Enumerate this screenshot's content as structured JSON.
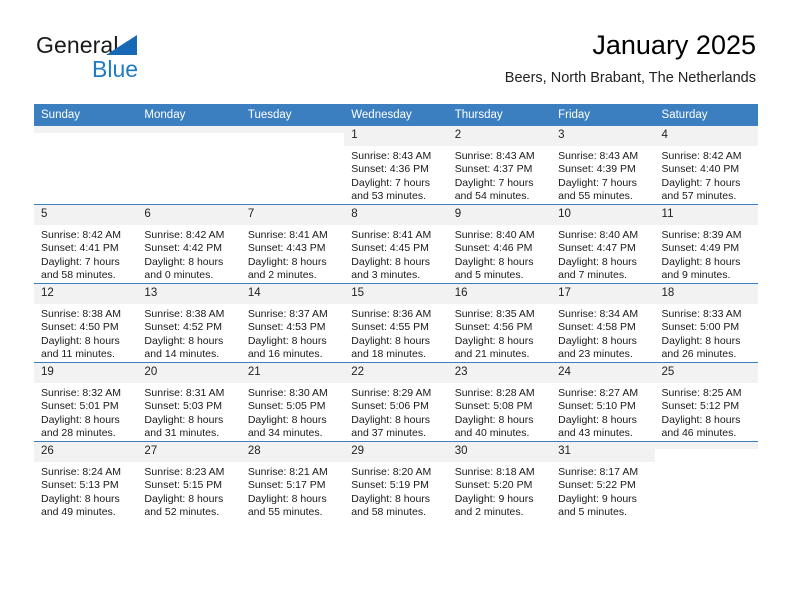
{
  "brand": {
    "name_top": "General",
    "name_bottom": "Blue",
    "accent_color": "#1f7cc4",
    "triangle_color": "#1769b5"
  },
  "header": {
    "title": "January 2025",
    "subtitle": "Beers, North Brabant, The Netherlands"
  },
  "theme": {
    "header_row_bg": "#3c7fc0",
    "daynum_bg": "#f2f2f2",
    "grid_line": "#3c7fc0",
    "text": "#1a1a1a"
  },
  "weekday_headers": [
    "Sunday",
    "Monday",
    "Tuesday",
    "Wednesday",
    "Thursday",
    "Friday",
    "Saturday"
  ],
  "weeks": [
    [
      {
        "day": "",
        "sunrise": "",
        "sunset": "",
        "daylight1": "",
        "daylight2": ""
      },
      {
        "day": "",
        "sunrise": "",
        "sunset": "",
        "daylight1": "",
        "daylight2": ""
      },
      {
        "day": "",
        "sunrise": "",
        "sunset": "",
        "daylight1": "",
        "daylight2": ""
      },
      {
        "day": "1",
        "sunrise": "Sunrise: 8:43 AM",
        "sunset": "Sunset: 4:36 PM",
        "daylight1": "Daylight: 7 hours",
        "daylight2": "and 53 minutes."
      },
      {
        "day": "2",
        "sunrise": "Sunrise: 8:43 AM",
        "sunset": "Sunset: 4:37 PM",
        "daylight1": "Daylight: 7 hours",
        "daylight2": "and 54 minutes."
      },
      {
        "day": "3",
        "sunrise": "Sunrise: 8:43 AM",
        "sunset": "Sunset: 4:39 PM",
        "daylight1": "Daylight: 7 hours",
        "daylight2": "and 55 minutes."
      },
      {
        "day": "4",
        "sunrise": "Sunrise: 8:42 AM",
        "sunset": "Sunset: 4:40 PM",
        "daylight1": "Daylight: 7 hours",
        "daylight2": "and 57 minutes."
      }
    ],
    [
      {
        "day": "5",
        "sunrise": "Sunrise: 8:42 AM",
        "sunset": "Sunset: 4:41 PM",
        "daylight1": "Daylight: 7 hours",
        "daylight2": "and 58 minutes."
      },
      {
        "day": "6",
        "sunrise": "Sunrise: 8:42 AM",
        "sunset": "Sunset: 4:42 PM",
        "daylight1": "Daylight: 8 hours",
        "daylight2": "and 0 minutes."
      },
      {
        "day": "7",
        "sunrise": "Sunrise: 8:41 AM",
        "sunset": "Sunset: 4:43 PM",
        "daylight1": "Daylight: 8 hours",
        "daylight2": "and 2 minutes."
      },
      {
        "day": "8",
        "sunrise": "Sunrise: 8:41 AM",
        "sunset": "Sunset: 4:45 PM",
        "daylight1": "Daylight: 8 hours",
        "daylight2": "and 3 minutes."
      },
      {
        "day": "9",
        "sunrise": "Sunrise: 8:40 AM",
        "sunset": "Sunset: 4:46 PM",
        "daylight1": "Daylight: 8 hours",
        "daylight2": "and 5 minutes."
      },
      {
        "day": "10",
        "sunrise": "Sunrise: 8:40 AM",
        "sunset": "Sunset: 4:47 PM",
        "daylight1": "Daylight: 8 hours",
        "daylight2": "and 7 minutes."
      },
      {
        "day": "11",
        "sunrise": "Sunrise: 8:39 AM",
        "sunset": "Sunset: 4:49 PM",
        "daylight1": "Daylight: 8 hours",
        "daylight2": "and 9 minutes."
      }
    ],
    [
      {
        "day": "12",
        "sunrise": "Sunrise: 8:38 AM",
        "sunset": "Sunset: 4:50 PM",
        "daylight1": "Daylight: 8 hours",
        "daylight2": "and 11 minutes."
      },
      {
        "day": "13",
        "sunrise": "Sunrise: 8:38 AM",
        "sunset": "Sunset: 4:52 PM",
        "daylight1": "Daylight: 8 hours",
        "daylight2": "and 14 minutes."
      },
      {
        "day": "14",
        "sunrise": "Sunrise: 8:37 AM",
        "sunset": "Sunset: 4:53 PM",
        "daylight1": "Daylight: 8 hours",
        "daylight2": "and 16 minutes."
      },
      {
        "day": "15",
        "sunrise": "Sunrise: 8:36 AM",
        "sunset": "Sunset: 4:55 PM",
        "daylight1": "Daylight: 8 hours",
        "daylight2": "and 18 minutes."
      },
      {
        "day": "16",
        "sunrise": "Sunrise: 8:35 AM",
        "sunset": "Sunset: 4:56 PM",
        "daylight1": "Daylight: 8 hours",
        "daylight2": "and 21 minutes."
      },
      {
        "day": "17",
        "sunrise": "Sunrise: 8:34 AM",
        "sunset": "Sunset: 4:58 PM",
        "daylight1": "Daylight: 8 hours",
        "daylight2": "and 23 minutes."
      },
      {
        "day": "18",
        "sunrise": "Sunrise: 8:33 AM",
        "sunset": "Sunset: 5:00 PM",
        "daylight1": "Daylight: 8 hours",
        "daylight2": "and 26 minutes."
      }
    ],
    [
      {
        "day": "19",
        "sunrise": "Sunrise: 8:32 AM",
        "sunset": "Sunset: 5:01 PM",
        "daylight1": "Daylight: 8 hours",
        "daylight2": "and 28 minutes."
      },
      {
        "day": "20",
        "sunrise": "Sunrise: 8:31 AM",
        "sunset": "Sunset: 5:03 PM",
        "daylight1": "Daylight: 8 hours",
        "daylight2": "and 31 minutes."
      },
      {
        "day": "21",
        "sunrise": "Sunrise: 8:30 AM",
        "sunset": "Sunset: 5:05 PM",
        "daylight1": "Daylight: 8 hours",
        "daylight2": "and 34 minutes."
      },
      {
        "day": "22",
        "sunrise": "Sunrise: 8:29 AM",
        "sunset": "Sunset: 5:06 PM",
        "daylight1": "Daylight: 8 hours",
        "daylight2": "and 37 minutes."
      },
      {
        "day": "23",
        "sunrise": "Sunrise: 8:28 AM",
        "sunset": "Sunset: 5:08 PM",
        "daylight1": "Daylight: 8 hours",
        "daylight2": "and 40 minutes."
      },
      {
        "day": "24",
        "sunrise": "Sunrise: 8:27 AM",
        "sunset": "Sunset: 5:10 PM",
        "daylight1": "Daylight: 8 hours",
        "daylight2": "and 43 minutes."
      },
      {
        "day": "25",
        "sunrise": "Sunrise: 8:25 AM",
        "sunset": "Sunset: 5:12 PM",
        "daylight1": "Daylight: 8 hours",
        "daylight2": "and 46 minutes."
      }
    ],
    [
      {
        "day": "26",
        "sunrise": "Sunrise: 8:24 AM",
        "sunset": "Sunset: 5:13 PM",
        "daylight1": "Daylight: 8 hours",
        "daylight2": "and 49 minutes."
      },
      {
        "day": "27",
        "sunrise": "Sunrise: 8:23 AM",
        "sunset": "Sunset: 5:15 PM",
        "daylight1": "Daylight: 8 hours",
        "daylight2": "and 52 minutes."
      },
      {
        "day": "28",
        "sunrise": "Sunrise: 8:21 AM",
        "sunset": "Sunset: 5:17 PM",
        "daylight1": "Daylight: 8 hours",
        "daylight2": "and 55 minutes."
      },
      {
        "day": "29",
        "sunrise": "Sunrise: 8:20 AM",
        "sunset": "Sunset: 5:19 PM",
        "daylight1": "Daylight: 8 hours",
        "daylight2": "and 58 minutes."
      },
      {
        "day": "30",
        "sunrise": "Sunrise: 8:18 AM",
        "sunset": "Sunset: 5:20 PM",
        "daylight1": "Daylight: 9 hours",
        "daylight2": "and 2 minutes."
      },
      {
        "day": "31",
        "sunrise": "Sunrise: 8:17 AM",
        "sunset": "Sunset: 5:22 PM",
        "daylight1": "Daylight: 9 hours",
        "daylight2": "and 5 minutes."
      },
      {
        "day": "",
        "sunrise": "",
        "sunset": "",
        "daylight1": "",
        "daylight2": ""
      }
    ]
  ]
}
